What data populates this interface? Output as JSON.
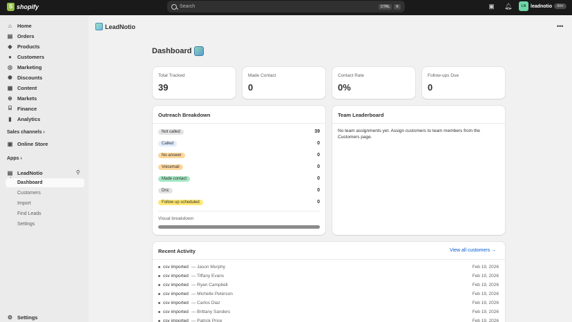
{
  "topbar": {
    "brand": "shopify",
    "search_placeholder": "Search",
    "kbd_ctrl": "CTRL",
    "kbd_k": "K",
    "user_initials": "LN",
    "store_name": "leadnotio",
    "store_badge": "dev"
  },
  "sidebar": {
    "items": [
      {
        "label": "Home",
        "icon": "home-icon"
      },
      {
        "label": "Orders",
        "icon": "orders-icon"
      },
      {
        "label": "Products",
        "icon": "tag-icon"
      },
      {
        "label": "Customers",
        "icon": "person-icon"
      },
      {
        "label": "Marketing",
        "icon": "target-icon"
      },
      {
        "label": "Discounts",
        "icon": "discount-icon"
      },
      {
        "label": "Content",
        "icon": "content-icon"
      },
      {
        "label": "Markets",
        "icon": "globe-icon"
      },
      {
        "label": "Finance",
        "icon": "bank-icon"
      },
      {
        "label": "Analytics",
        "icon": "chart-icon"
      }
    ],
    "sales_channels_label": "Sales channels",
    "online_store_label": "Online Store",
    "apps_label": "Apps",
    "app_name": "LeadNotio",
    "app_sub_items": [
      "Dashboard",
      "Customers",
      "Import",
      "Find Leads",
      "Settings"
    ],
    "settings_label": "Settings"
  },
  "main": {
    "app_title": "LeadNotio",
    "page_title": "Dashboard",
    "stats": [
      {
        "label": "Total Tracked",
        "value": "39"
      },
      {
        "label": "Made Contact",
        "value": "0"
      },
      {
        "label": "Contact Rate",
        "value": "0%"
      },
      {
        "label": "Follow-ups Due",
        "value": "0"
      }
    ],
    "outreach": {
      "title": "Outreach Breakdown",
      "rows": [
        {
          "label": "Not called",
          "count": "39",
          "color": "#e3e3e3"
        },
        {
          "label": "Called",
          "count": "0",
          "color": "#e0ecff"
        },
        {
          "label": "No answer",
          "count": "0",
          "color": "#ffd79d"
        },
        {
          "label": "Voicemail",
          "count": "0",
          "color": "#ffd79d"
        },
        {
          "label": "Made contact",
          "count": "0",
          "color": "#a5e8c4"
        },
        {
          "label": "Dnc",
          "count": "0",
          "color": "#e3e3e3"
        },
        {
          "label": "Follow up scheduled",
          "count": "0",
          "color": "#ffe873"
        }
      ],
      "visual_label": "Visual breakdown",
      "visual_fill": 1.0
    },
    "leaderboard": {
      "title": "Team Leaderboard",
      "empty_text": "No team assignments yet. Assign customers to team members from the Customers page."
    },
    "activity": {
      "title": "Recent Activity",
      "view_all": "View all customers →",
      "rows": [
        {
          "action": "csv imported",
          "name": "— Jason Murphy",
          "date": "Feb 19, 2026"
        },
        {
          "action": "csv imported",
          "name": "— Tiffany Evans",
          "date": "Feb 19, 2026"
        },
        {
          "action": "csv imported",
          "name": "— Ryan Campbell",
          "date": "Feb 19, 2026"
        },
        {
          "action": "csv imported",
          "name": "— Michelle Peterson",
          "date": "Feb 19, 2026"
        },
        {
          "action": "csv imported",
          "name": "— Carlos Diaz",
          "date": "Feb 19, 2026"
        },
        {
          "action": "csv imported",
          "name": "— Brittany Sanders",
          "date": "Feb 19, 2026"
        },
        {
          "action": "csv imported",
          "name": "— Patrick Price",
          "date": "Feb 19, 2026"
        }
      ]
    }
  }
}
